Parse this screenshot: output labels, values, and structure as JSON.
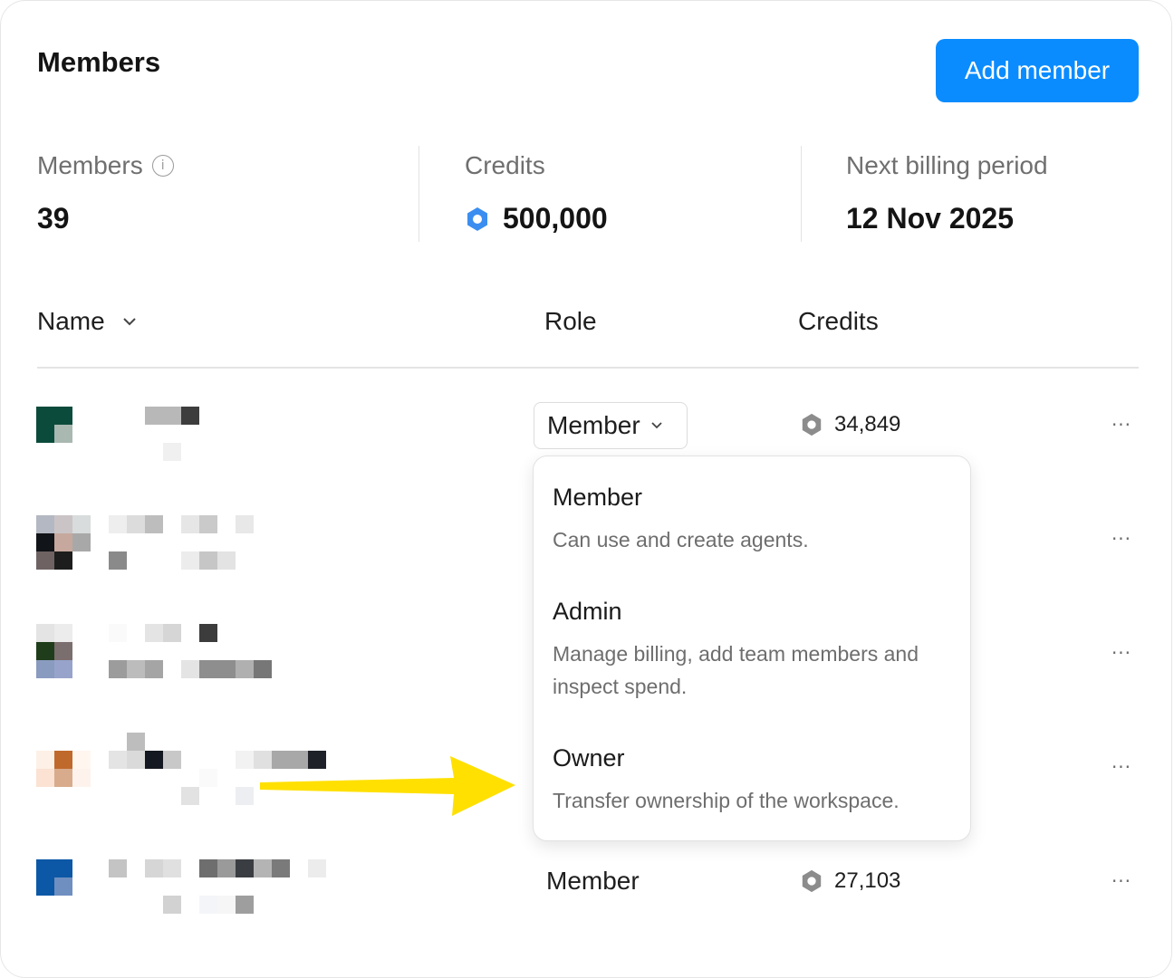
{
  "header": {
    "title": "Members",
    "add_button": "Add member"
  },
  "stats": {
    "members": {
      "label": "Members",
      "value": "39"
    },
    "credits": {
      "label": "Credits",
      "value": "500,000"
    },
    "billing": {
      "label": "Next billing period",
      "value": "12 Nov 2025"
    }
  },
  "table": {
    "columns": {
      "name": "Name",
      "role": "Role",
      "credits": "Credits"
    },
    "rows": [
      {
        "role": "Member",
        "role_is_select": true,
        "credits": "34,849"
      },
      {
        "role": "",
        "credits": ""
      },
      {
        "role": "",
        "credits": ""
      },
      {
        "role": "",
        "credits": ""
      },
      {
        "role": "Member",
        "credits": "27,103"
      }
    ],
    "more_glyph": "···"
  },
  "role_dropdown": {
    "options": [
      {
        "title": "Member",
        "description": "Can use and create agents."
      },
      {
        "title": "Admin",
        "description": "Manage billing, add team members and inspect spend."
      },
      {
        "title": "Owner",
        "description": "Transfer ownership of the workspace."
      }
    ]
  },
  "colors": {
    "accent": "#0a8cff",
    "credit_icon_blue": "#3b8ef0",
    "credit_icon_gray": "#8c8c8c",
    "annotation_arrow": "#ffe000"
  },
  "icons": [
    "info-icon",
    "credit-hex-icon",
    "chevron-down-icon",
    "more-dots-icon",
    "annotation-arrow"
  ]
}
